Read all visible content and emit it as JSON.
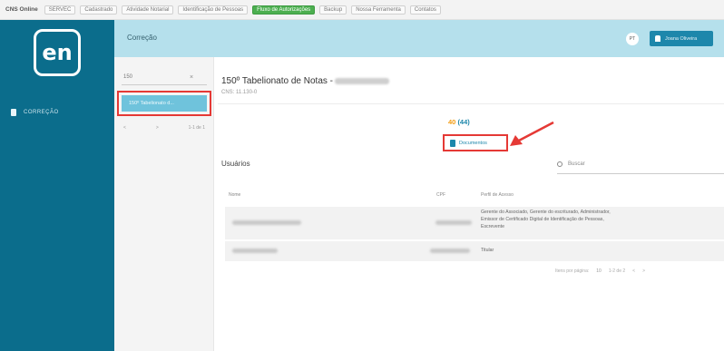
{
  "topbar": {
    "brand": "CNS Online",
    "tabs": [
      "SERVEC",
      "Cadastrado",
      "Atividade Notarial",
      "Identificação de Pessoas",
      "Fluxo de Autorizações",
      "Backup",
      "Nossa Ferramenta",
      "Contatos"
    ],
    "active_tab": "Fluxo de Autorizações"
  },
  "sidebar": {
    "logo_text": "en",
    "items": [
      {
        "label": "CORREÇÃO",
        "icon": "document-icon"
      }
    ]
  },
  "header": {
    "title": "Correção",
    "avatar_initials": "PT",
    "user_button_label": "Joana Oliveira"
  },
  "list": {
    "search_value": "150",
    "clear_label": "×",
    "selected_item_label": "150º Tabelionato d...",
    "pager": {
      "prev": "<",
      "next": ">",
      "range": "1-1 de 1"
    }
  },
  "detail": {
    "title": "150º Tabelionato de Notas -",
    "cns": "CNS: 11.130-0",
    "count_highlight": "40",
    "count_total": "(44)",
    "documents_button_label": "Documentos"
  },
  "users": {
    "section_title": "Usuários",
    "search_placeholder": "Buscar",
    "columns": [
      "Nome",
      "CPF",
      "Perfil de Acesso"
    ],
    "rows": [
      {
        "profile_lines": [
          "Gerente do Associado, Gerente do escriturado, Administrador,",
          "Emissor de Certificado Digital de Identificação de Pessoas,",
          "Escrevente"
        ]
      },
      {
        "profile_lines": [
          "Titular"
        ]
      }
    ],
    "footer": {
      "items_per_page_label": "Itens por página:",
      "items_per_page_value": "10",
      "range": "1-2 de 2",
      "prev": "<",
      "next": ">"
    }
  },
  "colors": {
    "sidebar": "#0b6d8c",
    "header": "#b5e0ec",
    "accent": "#1d87ab",
    "highlight": "#e53935",
    "orange": "#f39c12"
  }
}
